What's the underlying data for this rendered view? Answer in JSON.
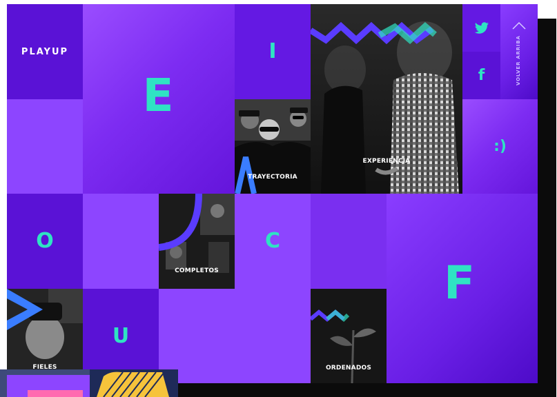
{
  "brand": {
    "logo": "PLAYUP"
  },
  "letters": {
    "e": "E",
    "i": "I",
    "o": "O",
    "c": "C",
    "f": "F",
    "u": "U",
    "smile": ":)"
  },
  "tiles": {
    "trayectoria": "TRAYECTORIA",
    "experiencia": "EXPERIENCIA",
    "completos": "COMPLETOS",
    "fieles": "FIELES",
    "ordenados": "ORDENADOS"
  },
  "social": {
    "twitter_icon": "twitter-icon",
    "facebook_label": "f"
  },
  "back_to_top": {
    "label": "VOLVER ARRIBA",
    "icon": "chevron-up-icon"
  },
  "colors": {
    "accent": "#2fe3c3",
    "primary": "#6a1fd8",
    "dark": "#151515"
  }
}
